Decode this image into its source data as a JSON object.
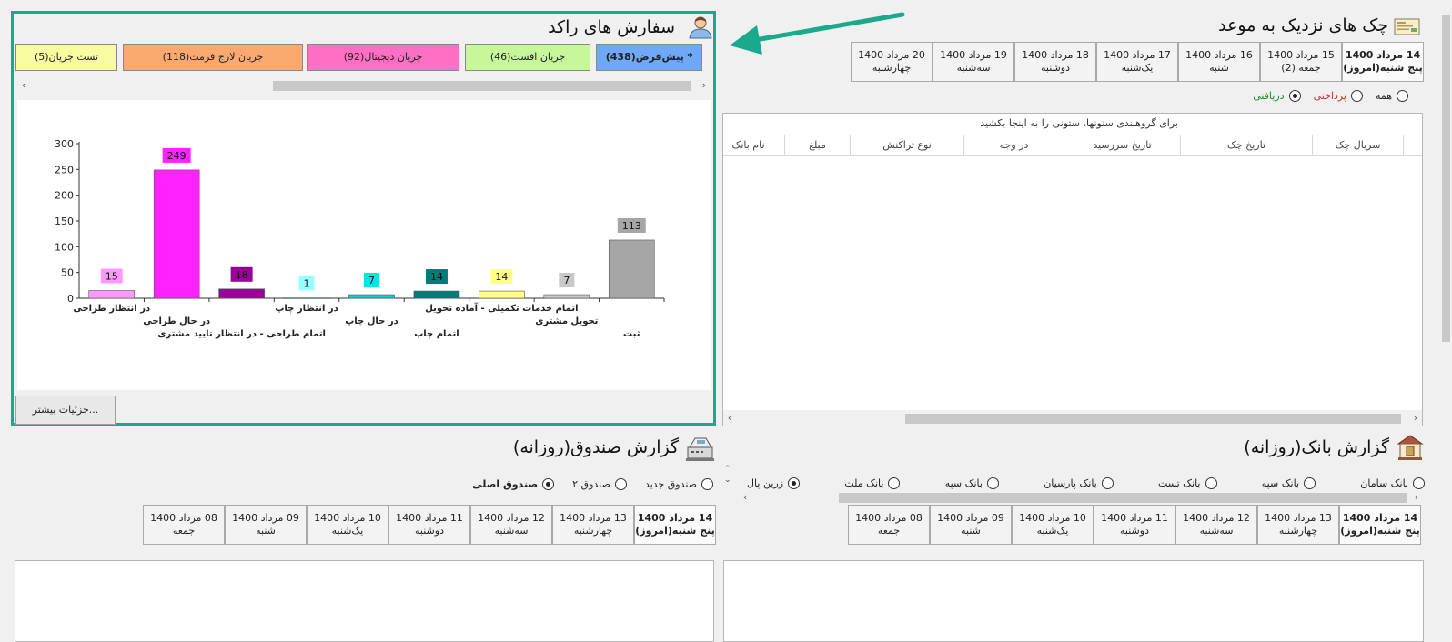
{
  "cheques": {
    "title": "چک های نزدیک به موعد",
    "dates": [
      {
        "line1": "14 مرداد 1400",
        "line2": "پنج شنبه(امروز)",
        "active": true
      },
      {
        "line1": "15 مرداد 1400",
        "line2": "جمعه (2)",
        "active": false
      },
      {
        "line1": "16 مرداد 1400",
        "line2": "شنبه",
        "active": false
      },
      {
        "line1": "17 مرداد 1400",
        "line2": "یک‌شنبه",
        "active": false
      },
      {
        "line1": "18 مرداد 1400",
        "line2": "دوشنبه",
        "active": false
      },
      {
        "line1": "19 مرداد 1400",
        "line2": "سه‌شنبه",
        "active": false
      },
      {
        "line1": "20 مرداد 1400",
        "line2": "چهارشنبه",
        "active": false
      }
    ],
    "radios": [
      {
        "label": "دریافتی",
        "checked": true,
        "color": "#1a8f2a"
      },
      {
        "label": "پرداختی",
        "checked": false,
        "color": "#c0392b"
      },
      {
        "label": "همه",
        "checked": false,
        "color": "#222"
      }
    ],
    "group_hint": "برای گروهبندی ستونها، ستونی را به اینجا بکشید",
    "columns": [
      "سریال چک",
      "تاریخ چک",
      "تاریخ سررسید",
      "در وجه",
      "نوع تراکنش",
      "مبلغ",
      "نام بانک"
    ]
  },
  "orders": {
    "title": "سفارش های راکد",
    "tabs": [
      {
        "label": "* پیش‌فرض(438)",
        "color": "#6fa8f7",
        "bold": true
      },
      {
        "label": "جریان افست(46)",
        "color": "#c6f79a",
        "bold": false
      },
      {
        "label": "جریان دیجیتال(92)",
        "color": "#ff6fc4",
        "bold": false
      },
      {
        "label": "جریان لارج فرمت(118)",
        "color": "#fba971",
        "bold": false
      },
      {
        "label": "تست جریان(5)",
        "color": "#f9fba0",
        "bold": false
      }
    ],
    "more_button": "جزئیات بیشتر..."
  },
  "chart_data": {
    "type": "bar",
    "categories": [
      "در انتظار طراحی",
      "در حال طراحی",
      "اتمام طراحی - در انتظار تایید مشتری",
      "در انتظار چاپ",
      "در حال چاپ",
      "اتمام چاپ",
      "اتمام خدمات تکمیلی - آماده تحویل",
      "تحویل مشتری",
      "ثبت"
    ],
    "values": [
      15,
      249,
      18,
      1,
      7,
      14,
      14,
      7,
      113
    ],
    "colors": [
      "#ff99ff",
      "#ff22ff",
      "#9b009b",
      "#99ffff",
      "#00d2d2",
      "#007a7a",
      "#ffff88",
      "#c8c8c8",
      "#a6a6a6"
    ],
    "label_colors": [
      "#ff99ff",
      "#ff22ff",
      "#9b009b",
      "#99ffff",
      "#00e5e5",
      "#007a7a",
      "#ffff88",
      "#c8c8c8",
      "#a6a6a6"
    ],
    "yticks": [
      "0",
      "50",
      "100",
      "150",
      "200",
      "250",
      "300"
    ],
    "ylim": [
      0,
      300
    ],
    "grid": false
  },
  "bank": {
    "title": "گزارش بانک(روزانه)",
    "radios": [
      {
        "label": "زرین پال",
        "checked": true
      },
      {
        "label": "بانک ملت",
        "checked": false
      },
      {
        "label": "بانک سپه",
        "checked": false
      },
      {
        "label": "بانک پارسیان",
        "checked": false
      },
      {
        "label": "بانک تست",
        "checked": false
      },
      {
        "label": "بانک سپه",
        "checked": false
      },
      {
        "label": "بانک سامان",
        "checked": false
      }
    ],
    "dates": [
      {
        "line1": "14 مرداد 1400",
        "line2": "پنج شنبه(امروز)",
        "active": true
      },
      {
        "line1": "13 مرداد 1400",
        "line2": "چهارشنبه",
        "active": false
      },
      {
        "line1": "12 مرداد 1400",
        "line2": "سه‌شنبه",
        "active": false
      },
      {
        "line1": "11 مرداد 1400",
        "line2": "دوشنبه",
        "active": false
      },
      {
        "line1": "10 مرداد 1400",
        "line2": "یک‌شنبه",
        "active": false
      },
      {
        "line1": "09 مرداد 1400",
        "line2": "شنبه",
        "active": false
      },
      {
        "line1": "08 مرداد 1400",
        "line2": "جمعه",
        "active": false
      }
    ]
  },
  "cash": {
    "title": "گزارش صندوق(روزانه)",
    "radios": [
      {
        "label": "صندوق اصلی",
        "checked": true,
        "bold": true
      },
      {
        "label": "صندوق ۲",
        "checked": false,
        "bold": false
      },
      {
        "label": "صندوق جدید",
        "checked": false,
        "bold": false
      }
    ],
    "dates": [
      {
        "line1": "14 مرداد 1400",
        "line2": "پنج شنبه(امروز)",
        "active": true
      },
      {
        "line1": "13 مرداد 1400",
        "line2": "چهارشنبه",
        "active": false
      },
      {
        "line1": "12 مرداد 1400",
        "line2": "سه‌شنبه",
        "active": false
      },
      {
        "line1": "11 مرداد 1400",
        "line2": "دوشنبه",
        "active": false
      },
      {
        "line1": "10 مرداد 1400",
        "line2": "یک‌شنبه",
        "active": false
      },
      {
        "line1": "09 مرداد 1400",
        "line2": "شنبه",
        "active": false
      },
      {
        "line1": "08 مرداد 1400",
        "line2": "جمعه",
        "active": false
      }
    ]
  },
  "colors": {
    "accent": "#1aa98a",
    "arrow": "#1aa98a"
  }
}
